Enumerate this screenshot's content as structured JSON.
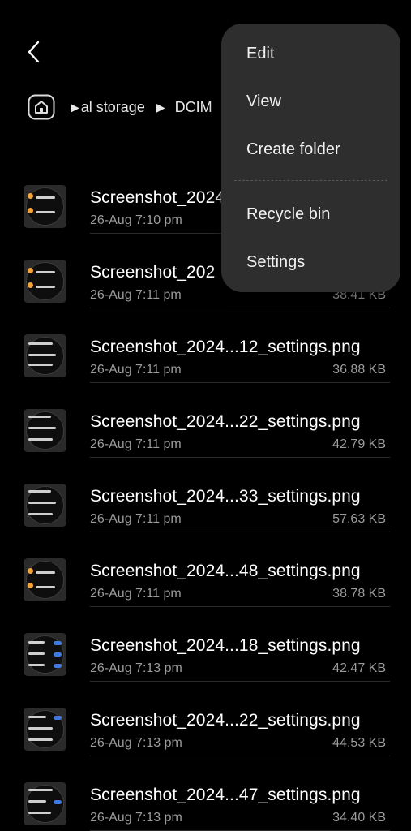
{
  "nav": {
    "back_icon": "chevron-left-icon",
    "home_icon": "home-icon"
  },
  "breadcrumb": {
    "items": [
      "al storage",
      "DCIM"
    ]
  },
  "menu": {
    "items": [
      "Edit",
      "View",
      "Create folder",
      "Recycle bin",
      "Settings"
    ]
  },
  "files": [
    {
      "name": "Screenshot_2024",
      "date": "26-Aug 7:10 pm",
      "size": ""
    },
    {
      "name": "Screenshot_202",
      "date": "26-Aug 7:11 pm",
      "size": "38.41 KB"
    },
    {
      "name": "Screenshot_2024...12_settings.png",
      "date": "26-Aug 7:11 pm",
      "size": "36.88 KB"
    },
    {
      "name": "Screenshot_2024...22_settings.png",
      "date": "26-Aug 7:11 pm",
      "size": "42.79 KB"
    },
    {
      "name": "Screenshot_2024...33_settings.png",
      "date": "26-Aug 7:11 pm",
      "size": "57.63 KB"
    },
    {
      "name": "Screenshot_2024...48_settings.png",
      "date": "26-Aug 7:11 pm",
      "size": "38.78 KB"
    },
    {
      "name": "Screenshot_2024...18_settings.png",
      "date": "26-Aug 7:13 pm",
      "size": "42.47 KB"
    },
    {
      "name": "Screenshot_2024...22_settings.png",
      "date": "26-Aug 7:13 pm",
      "size": "44.53 KB"
    },
    {
      "name": "Screenshot_2024...47_settings.png",
      "date": "26-Aug 7:13 pm",
      "size": "34.40 KB"
    }
  ],
  "colors": {
    "background": "#000000",
    "menu_background": "#2e2e2e",
    "secondary_text": "#9b9b9b"
  }
}
